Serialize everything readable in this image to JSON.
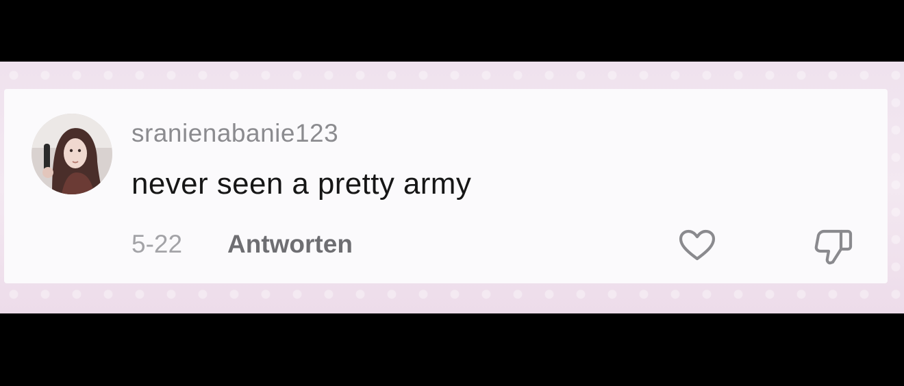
{
  "comment": {
    "username": "sranienabanie123",
    "text": "never seen a pretty army",
    "date": "5-22",
    "reply_label": "Antworten"
  },
  "icons": {
    "avatar": "user-avatar",
    "like": "heart-outline-icon",
    "dislike": "thumbs-down-outline-icon"
  },
  "colors": {
    "card_background": "#fbfafc",
    "frame_background": "#f1e4ef",
    "username": "#8b8b8f",
    "comment_text": "#161616",
    "date": "#a3a3a7",
    "reply": "#6e6e72",
    "icon_stroke": "#8a8a8e"
  }
}
